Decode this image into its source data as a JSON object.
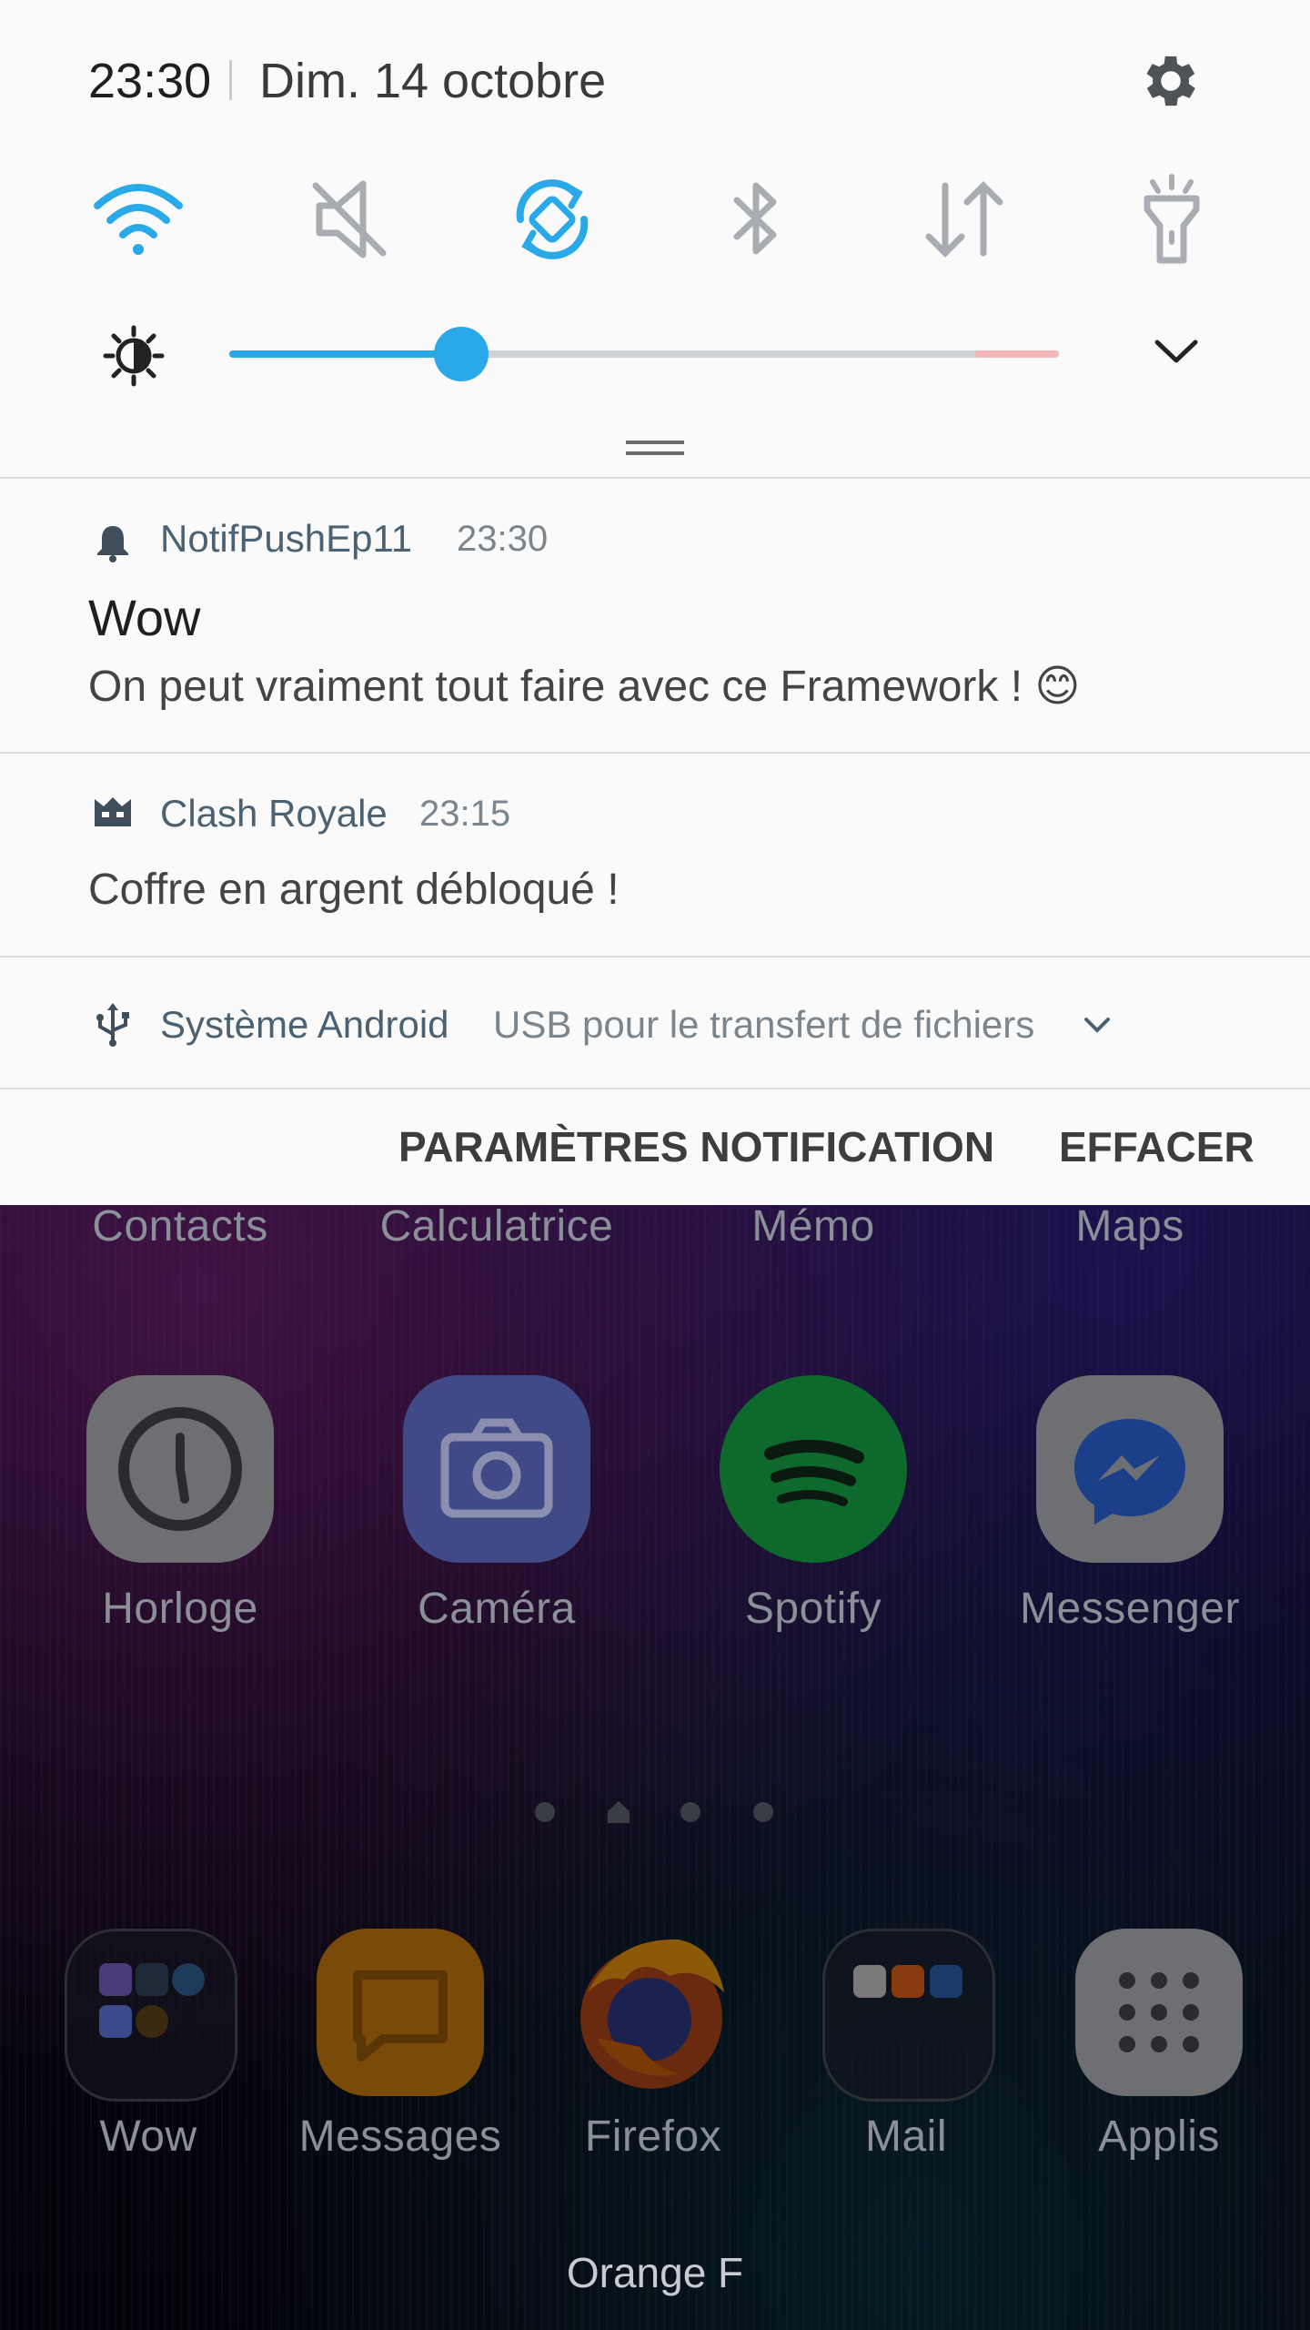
{
  "header": {
    "time": "23:30",
    "date": "Dim. 14 octobre"
  },
  "quick_settings": [
    {
      "name": "wifi",
      "icon": "wifi-icon",
      "active": true
    },
    {
      "name": "sound",
      "icon": "mute-icon",
      "active": false
    },
    {
      "name": "auto-rotate",
      "icon": "rotate-icon",
      "active": true
    },
    {
      "name": "bluetooth",
      "icon": "bluetooth-icon",
      "active": false
    },
    {
      "name": "mobile-data",
      "icon": "data-icon",
      "active": false
    },
    {
      "name": "flashlight",
      "icon": "flashlight-icon",
      "active": false
    }
  ],
  "brightness": {
    "level": 0.28,
    "icon": "brightness-icon"
  },
  "notifications": [
    {
      "app": "NotifPushEp11",
      "time": "23:30",
      "title": "Wow",
      "body": "On peut vraiment tout faire avec ce Framework ! 😊",
      "icon": "bell-icon"
    },
    {
      "app": "Clash Royale",
      "time": "23:15",
      "body": "Coffre en argent débloqué !",
      "icon": "clash-royale-icon"
    }
  ],
  "system_notification": {
    "app": "Système Android",
    "text": "USB pour le transfert de fichiers",
    "icon": "usb-icon"
  },
  "actions": {
    "settings": "PARAMÈTRES NOTIFICATION",
    "clear": "EFFACER"
  },
  "home": {
    "top_row_labels": [
      "Contacts",
      "Calculatrice",
      "Mémo",
      "Maps"
    ],
    "apps": [
      {
        "label": "Horloge",
        "icon": "clock-icon"
      },
      {
        "label": "Caméra",
        "icon": "camera-icon"
      },
      {
        "label": "Spotify",
        "icon": "spotify-icon"
      },
      {
        "label": "Messenger",
        "icon": "messenger-icon"
      }
    ],
    "dock": [
      {
        "label": "Wow",
        "icon": "folder-icon"
      },
      {
        "label": "Messages",
        "icon": "messages-icon"
      },
      {
        "label": "Firefox",
        "icon": "firefox-icon"
      },
      {
        "label": "Mail",
        "icon": "mail-folder-icon"
      },
      {
        "label": "Applis",
        "icon": "apps-grid-icon"
      }
    ],
    "carrier": "Orange F"
  },
  "colors": {
    "accent": "#2aa9e8",
    "shade_bg": "#fafafa",
    "app_name": "#4c6272"
  }
}
